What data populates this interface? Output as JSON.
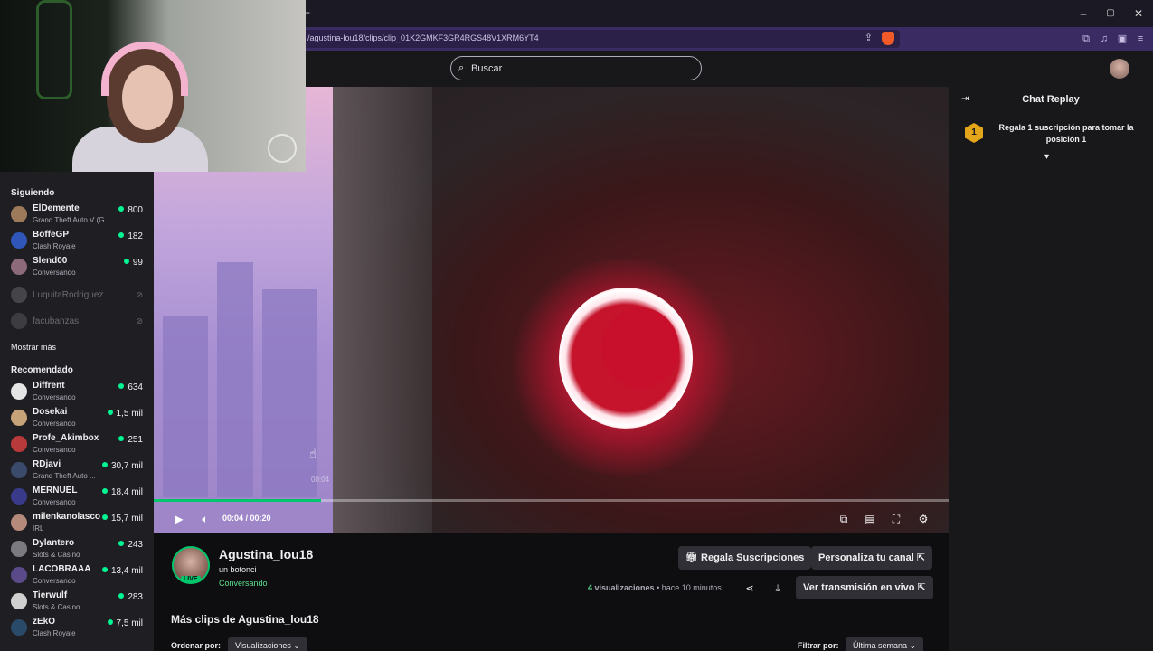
{
  "browser": {
    "url": "/agustina-lou18/clips/clip_01K2GMKF3GR4RGS48V1XRM6YT4",
    "new_tab": "+",
    "window_controls": [
      "–",
      "▢",
      "✕"
    ]
  },
  "topnav": {
    "search_placeholder": "Buscar"
  },
  "sidebar": {
    "following_title": "Siguiendo",
    "following": [
      {
        "name": "ElDemente",
        "game": "Grand Theft Auto V (G...",
        "viewers": "800",
        "avatar_color": "#9c7a5a"
      },
      {
        "name": "BoffeGP",
        "game": "Clash Royale",
        "viewers": "182",
        "avatar_color": "#2f56b8"
      },
      {
        "name": "Slend00",
        "game": "Conversando",
        "viewers": "99",
        "avatar_color": "#8c6a7a"
      }
    ],
    "offline": [
      {
        "name": "LuquitaRodriguez",
        "status": "⊘",
        "avatar_color": "#6a6a70"
      },
      {
        "name": "facubanzas",
        "status": "⊘",
        "avatar_color": "#5a5a60"
      }
    ],
    "show_more": "Mostrar más",
    "recommended_title": "Recomendado",
    "recommended": [
      {
        "name": "Diffrent",
        "game": "Conversando",
        "viewers": "634",
        "avatar_color": "#e5e5e5"
      },
      {
        "name": "Dosekai",
        "game": "Conversando",
        "viewers": "1,5 mil",
        "avatar_color": "#c7a37a"
      },
      {
        "name": "Profe_Akimbox",
        "game": "Conversando",
        "viewers": "251",
        "avatar_color": "#b83a3a"
      },
      {
        "name": "RDjavi",
        "game": "Grand Theft Auto ...",
        "viewers": "30,7 mil",
        "avatar_color": "#3a4a6a"
      },
      {
        "name": "MERNUEL",
        "game": "Conversando",
        "viewers": "18,4 mil",
        "avatar_color": "#3a3a8a"
      },
      {
        "name": "milenkanolasco",
        "game": "IRL",
        "viewers": "15,7 mil",
        "avatar_color": "#b58a7a"
      },
      {
        "name": "Dylantero",
        "game": "Slots & Casino",
        "viewers": "243",
        "avatar_color": "#7a7a80"
      },
      {
        "name": "LACOBRAAA",
        "game": "Conversando",
        "viewers": "13,4 mil",
        "avatar_color": "#5a4a8a"
      },
      {
        "name": "Tierwulf",
        "game": "Slots & Casino",
        "viewers": "283",
        "avatar_color": "#d0d0d0"
      },
      {
        "name": "zEkO",
        "game": "Clash Royale",
        "viewers": "7,5 mil",
        "avatar_color": "#2a4a6a"
      }
    ]
  },
  "player": {
    "time": "00:04 / 00:20",
    "progress": 0.21,
    "overlay_time": "00:04"
  },
  "chat": {
    "title": "Chat Replay",
    "gift_rank": "1",
    "gift_text": "Regala 1 suscripción para tomar la posición 1"
  },
  "clip": {
    "channel": "Agustina_lou18",
    "live_badge": "LIVE",
    "title": "un botonci",
    "category": "Conversando",
    "gift_button": "Regala Suscripciones",
    "customize_button": "Personaliza tu canal",
    "views_count": "4",
    "views_label": "visualizaciones",
    "separator": "•",
    "time_ago": "hace 10 minutos",
    "watch_live_button": "Ver transmisión en vivo",
    "more_clips_title": "Más clips de Agustina_lou18",
    "sort_label": "Ordenar por:",
    "sort_value": "Visualizaciones",
    "filter_label": "Filtrar por:",
    "filter_value": "Última semana"
  },
  "colors": {
    "accent_green": "#00c66b",
    "live_dot": "#00f593",
    "brand_purple": "#3a2b63"
  }
}
